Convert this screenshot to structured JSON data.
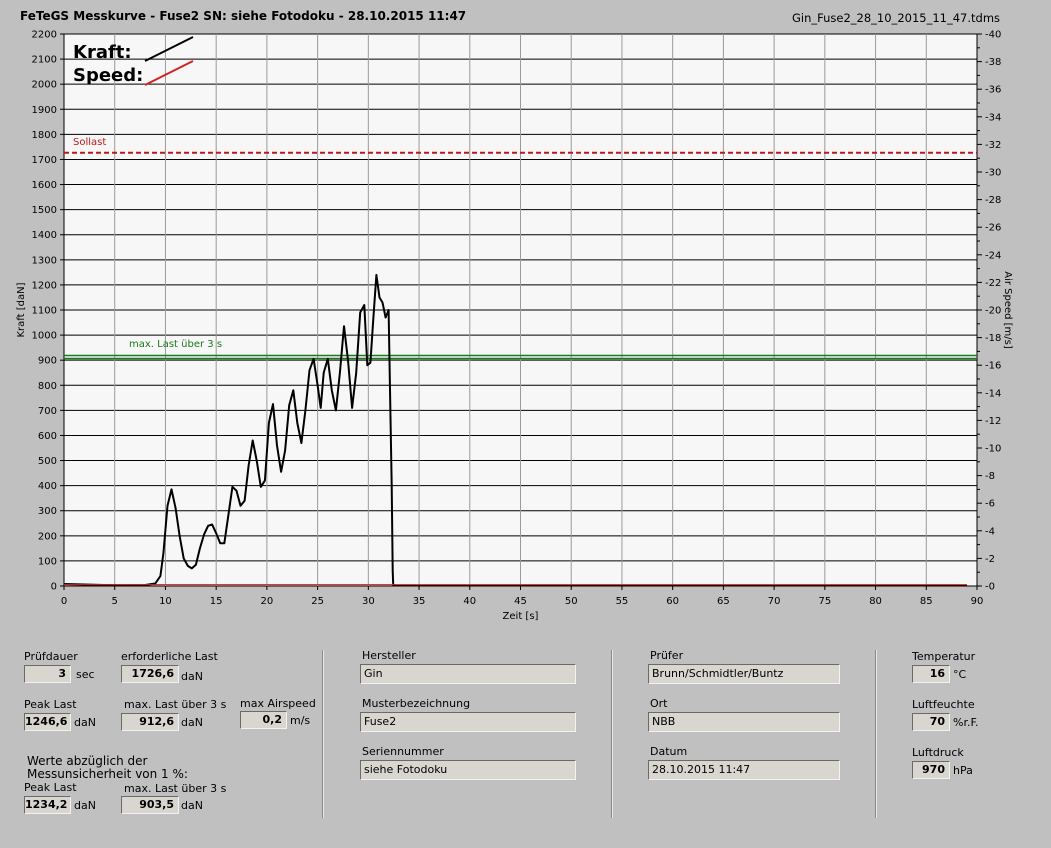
{
  "header": {
    "title": "FeTeGS Messkurve - Fuse2  SN: siehe Fotodoku - 28.10.2015 11:47",
    "filename": "Gin_Fuse2_28_10_2015_11_47.tdms"
  },
  "chart_data": {
    "type": "line",
    "xlabel": "Zeit [s]",
    "ylabel": "Kraft [daN]",
    "y2label": "Air Speed [m/s]",
    "xlim": [
      0,
      90
    ],
    "ylim": [
      0,
      2200
    ],
    "y2lim": [
      0,
      40
    ],
    "xticks": [
      0,
      5,
      10,
      15,
      20,
      25,
      30,
      35,
      40,
      45,
      50,
      55,
      60,
      65,
      70,
      75,
      80,
      85,
      90
    ],
    "yticks": [
      0,
      100,
      200,
      300,
      400,
      500,
      600,
      700,
      800,
      900,
      1000,
      1100,
      1200,
      1300,
      1400,
      1500,
      1600,
      1700,
      1800,
      1900,
      2000,
      2100,
      2200
    ],
    "y2ticks": [
      0,
      2,
      4,
      6,
      8,
      10,
      12,
      14,
      16,
      18,
      20,
      22,
      24,
      26,
      28,
      30,
      32,
      34,
      36,
      38,
      40
    ],
    "legend": {
      "placement": "top-left",
      "entries": [
        {
          "name": "Kraft:",
          "color": "#000000"
        },
        {
          "name": "Speed:",
          "color": "#d42020"
        }
      ]
    },
    "reference_lines": [
      {
        "name": "Sollast",
        "y": 1726.6,
        "color": "#c01818",
        "style": "dashed"
      },
      {
        "name": "max. Last über  3 s",
        "y": 912.6,
        "color": "#1a7a1a",
        "style": "solid"
      }
    ],
    "series": [
      {
        "name": "Kraft",
        "color": "#000000",
        "x": [
          0,
          2,
          4,
          6,
          8,
          9,
          9.5,
          9.8,
          10.2,
          10.6,
          11,
          11.4,
          11.8,
          12.2,
          12.6,
          13,
          13.4,
          13.8,
          14.2,
          14.6,
          15,
          15.4,
          15.8,
          16.2,
          16.6,
          17,
          17.4,
          17.8,
          18.2,
          18.6,
          19,
          19.4,
          19.8,
          20.2,
          20.6,
          21,
          21.4,
          21.8,
          22.2,
          22.6,
          23,
          23.4,
          23.8,
          24.2,
          24.6,
          25,
          25.3,
          25.6,
          26,
          26.4,
          26.8,
          27.2,
          27.6,
          28,
          28.4,
          28.8,
          29.2,
          29.6,
          29.9,
          30.2,
          30.5,
          30.8,
          31.1,
          31.4,
          31.7,
          32,
          32.3,
          32.4,
          32.45,
          32.7,
          40,
          50,
          60,
          70,
          80,
          89
        ],
        "values": [
          8,
          6,
          4,
          3,
          4,
          10,
          40,
          130,
          320,
          385,
          310,
          200,
          110,
          80,
          70,
          85,
          150,
          205,
          240,
          245,
          210,
          170,
          170,
          280,
          395,
          380,
          320,
          340,
          480,
          580,
          500,
          395,
          420,
          650,
          725,
          560,
          455,
          540,
          720,
          780,
          650,
          570,
          700,
          860,
          905,
          800,
          710,
          850,
          905,
          780,
          700,
          850,
          1035,
          900,
          710,
          850,
          1090,
          1120,
          880,
          890,
          1070,
          1240,
          1150,
          1130,
          1070,
          1100,
          400,
          60,
          5,
          2,
          2,
          2,
          2,
          2,
          2,
          2
        ]
      },
      {
        "name": "Speed",
        "color": "#d42020",
        "x": [
          0,
          89
        ],
        "values": [
          0.1,
          0.1
        ]
      }
    ]
  },
  "panel1": {
    "pruefdauer_label": "Prüfdauer",
    "pruefdauer_value": "3",
    "pruefdauer_unit": "sec",
    "erf_last_label": "erforderliche Last",
    "erf_last_value": "1726,6",
    "erf_last_unit": "daN",
    "peak_label": "Peak Last",
    "peak_value": "1246,6",
    "peak_unit": "daN",
    "maxlast_label": "max. Last über  3 s",
    "maxlast_value": "912,6",
    "maxlast_unit": "daN",
    "airspeed_label": "max Airspeed",
    "airspeed_value": "0,2",
    "airspeed_unit": "m/s",
    "werte_line1": "Werte abzüglich der",
    "werte_line2": "Messunsicherheit von 1  %:",
    "peak2_label": "Peak Last",
    "peak2_value": "1234,2",
    "peak2_unit": "daN",
    "maxlast2_label": "max. Last über  3 s",
    "maxlast2_value": "903,5",
    "maxlast2_unit": "daN"
  },
  "panel2": {
    "hersteller_label": "Hersteller",
    "hersteller_value": "Gin",
    "muster_label": "Musterbezeichnung",
    "muster_value": "Fuse2",
    "serie_label": "Seriennummer",
    "serie_value": "siehe Fotodoku"
  },
  "panel3": {
    "pruefer_label": "Prüfer",
    "pruefer_value": "Brunn/Schmidtler/Buntz",
    "ort_label": "Ort",
    "ort_value": "NBB",
    "datum_label": "Datum",
    "datum_value": "28.10.2015 11:47"
  },
  "panel4": {
    "temp_label": "Temperatur",
    "temp_value": "16",
    "temp_unit": "°C",
    "feuchte_label": "Luftfeuchte",
    "feuchte_value": "70",
    "feuchte_unit": "%r.F.",
    "druck_label": "Luftdruck",
    "druck_value": "970",
    "druck_unit": "hPa"
  }
}
